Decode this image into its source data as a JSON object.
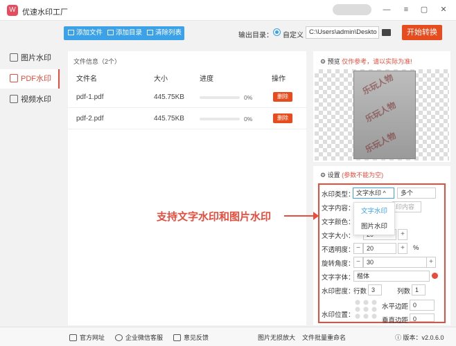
{
  "app": {
    "logo_glyph": "W",
    "title": "优速水印工厂"
  },
  "window": {
    "minimize": "—",
    "menu": "≡",
    "restore": "▢",
    "close": "✕"
  },
  "sidebar": {
    "items": [
      {
        "label": "图片水印",
        "icon": "image-icon",
        "active": false
      },
      {
        "label": "PDF水印",
        "icon": "pdf-icon",
        "active": true
      },
      {
        "label": "视频水印",
        "icon": "video-icon",
        "active": false
      }
    ]
  },
  "toolbar": {
    "add_file": "添加文件",
    "add_dir": "添加目录",
    "clear_list": "清除列表"
  },
  "output": {
    "label": "输出目录：",
    "custom": "自定义",
    "path": "C:\\Users\\admin\\Deskto",
    "start": "开始转换"
  },
  "filelist": {
    "info": "文件信息（2个）",
    "headers": {
      "name": "文件名",
      "size": "大小",
      "progress": "进度",
      "action": "操作"
    },
    "rows": [
      {
        "name": "pdf-1.pdf",
        "size": "445.75KB",
        "progress": "0%",
        "action": "删除"
      },
      {
        "name": "pdf-2.pdf",
        "size": "445.75KB",
        "progress": "0%",
        "action": "删除"
      }
    ]
  },
  "preview": {
    "label": "预览",
    "note": "仅作参考，请以实际为准!",
    "watermark_text": "乐玩人物"
  },
  "settings": {
    "label": "设置",
    "note": "(参数不能为空)",
    "type_label": "水印类型：",
    "type_value": "文字水印 ^",
    "count_value": "多个",
    "dropdown": [
      "文字水印",
      "图片水印"
    ],
    "text_label": "文字内容：",
    "text_placeholder": "印内容",
    "color_label": "文字颜色：",
    "size_label": "文字大小：",
    "size_value": "20",
    "opacity_label": "不透明度：",
    "opacity_value": "20",
    "opacity_unit": "%",
    "rotate_label": "旋转角度：",
    "rotate_value": "30",
    "font_label": "文字字体：",
    "font_value": "楷体",
    "density_label": "水印密度：",
    "rows_label": "行数",
    "rows_value": "3",
    "cols_label": "列数",
    "cols_value": "1",
    "position_label": "水印位置：",
    "hmargin_label": "水平边距",
    "hmargin_value": "0",
    "vmargin_label": "垂直边距",
    "vmargin_value": "0",
    "minus": "−",
    "plus": "+"
  },
  "annotation": "支持文字水印和图片水印",
  "footer": {
    "website": "官方网址",
    "wechat": "企业微信客服",
    "feedback": "意见反馈",
    "enlarge": "图片无损放大",
    "rename": "文件批量重命名",
    "version": "版本：v2.0.6.0"
  }
}
